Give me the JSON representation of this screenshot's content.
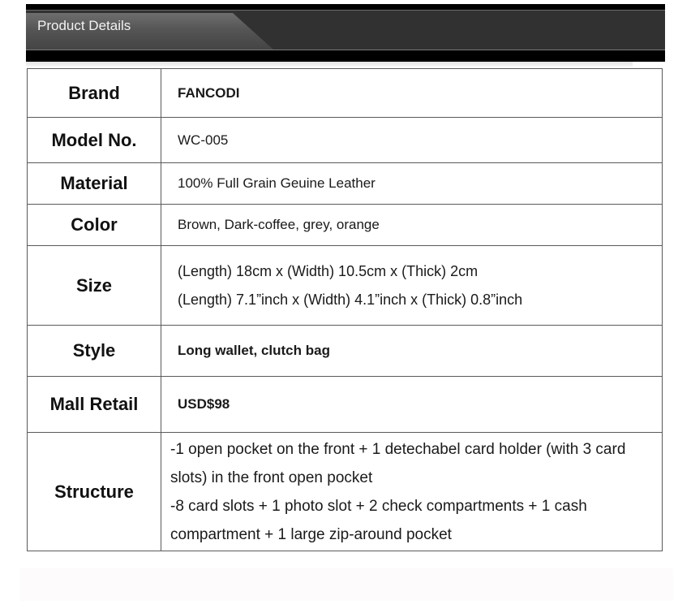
{
  "banner": {
    "title": "Product Details"
  },
  "specs": [
    {
      "label": "Brand",
      "value": "FANCODI"
    },
    {
      "label": "Model No.",
      "value": "WC-005"
    },
    {
      "label": "Material",
      "value": "100% Full Grain Geuine Leather"
    },
    {
      "label": "Color",
      "value": "Brown, Dark-coffee, grey, orange"
    },
    {
      "label": "Size",
      "lines": [
        "(Length) 18cm x (Width) 10.5cm x (Thick) 2cm",
        "(Length) 7.1”inch x (Width) 4.1”inch x (Thick) 0.8”inch"
      ]
    },
    {
      "label": "Style",
      "value": "Long wallet, clutch bag"
    },
    {
      "label": "Mall Retail",
      "value": "USD$98"
    },
    {
      "label": "Structure",
      "lines": [
        "-1 open pocket on the front + 1 detechabel card holder (with 3 card slots) in the front open pocket",
        "-8 card slots + 1 photo slot + 2 check compartments + 1 cash compartment + 1 large zip-around pocket"
      ]
    }
  ]
}
